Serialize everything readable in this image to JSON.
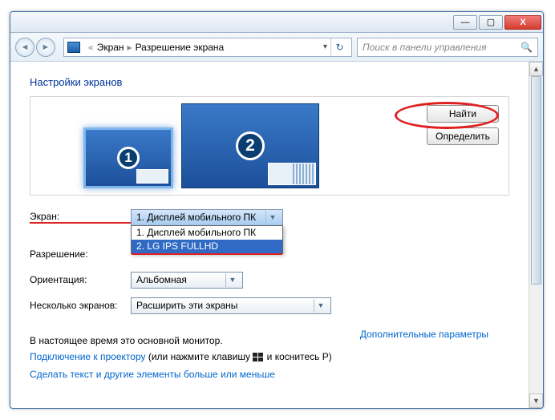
{
  "titlebar": {
    "min": "—",
    "max": "▢",
    "close": "X"
  },
  "nav": {
    "crumb1": "Экран",
    "crumb2": "Разрешение экрана",
    "search_placeholder": "Поиск в панели управления"
  },
  "heading": "Настройки экранов",
  "monitors": {
    "num1": "1",
    "num2": "2"
  },
  "buttons": {
    "find": "Найти",
    "identify": "Определить"
  },
  "form": {
    "screen_label": "Экран:",
    "screen_value": "1. Дисплей мобильного ПК",
    "screen_options": [
      "1. Дисплей мобильного ПК",
      "2. LG IPS FULLHD"
    ],
    "res_label": "Разрешение:",
    "orient_label": "Ориентация:",
    "orient_value": "Альбомная",
    "multi_label": "Несколько экранов:",
    "multi_value": "Расширить эти экраны"
  },
  "info": "В настоящее время это основной монитор.",
  "adv_link": "Дополнительные параметры",
  "link1_a": "Подключение к проектору",
  "link1_b": " (или нажмите клавишу ",
  "link1_c": " и коснитесь P)",
  "link2": "Сделать текст и другие элементы больше или меньше"
}
